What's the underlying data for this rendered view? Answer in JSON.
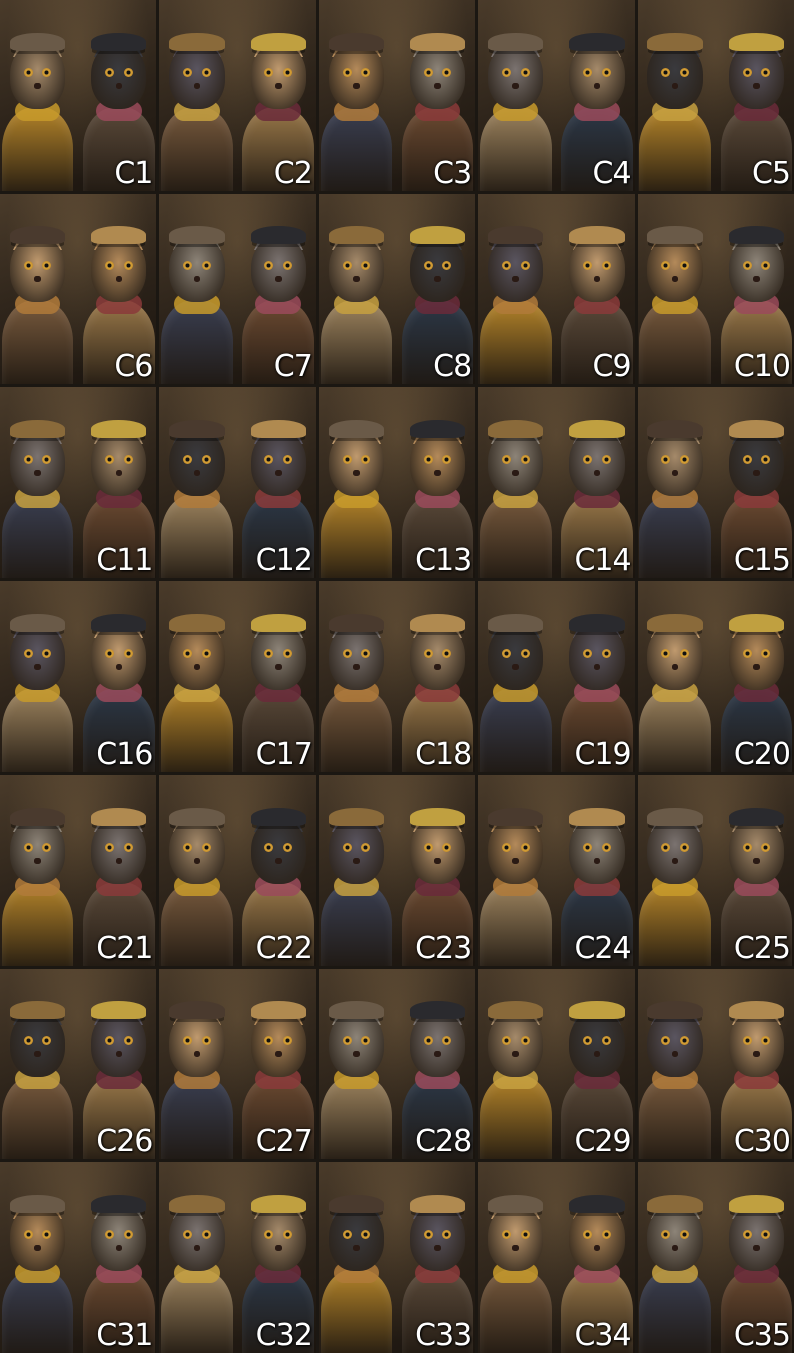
{
  "tiles": [
    {
      "label": "C1"
    },
    {
      "label": "C2"
    },
    {
      "label": "C3"
    },
    {
      "label": "C4"
    },
    {
      "label": "C5"
    },
    {
      "label": "C6"
    },
    {
      "label": "C7"
    },
    {
      "label": "C8"
    },
    {
      "label": "C9"
    },
    {
      "label": "C10"
    },
    {
      "label": "C11"
    },
    {
      "label": "C12"
    },
    {
      "label": "C13"
    },
    {
      "label": "C14"
    },
    {
      "label": "C15"
    },
    {
      "label": "C16"
    },
    {
      "label": "C17"
    },
    {
      "label": "C18"
    },
    {
      "label": "C19"
    },
    {
      "label": "C20"
    },
    {
      "label": "C21"
    },
    {
      "label": "C22"
    },
    {
      "label": "C23"
    },
    {
      "label": "C24"
    },
    {
      "label": "C25"
    },
    {
      "label": "C26"
    },
    {
      "label": "C27"
    },
    {
      "label": "C28"
    },
    {
      "label": "C29"
    },
    {
      "label": "C30"
    },
    {
      "label": "C31"
    },
    {
      "label": "C32"
    },
    {
      "label": "C33"
    },
    {
      "label": "C34"
    },
    {
      "label": "C35"
    }
  ],
  "palette": {
    "background": "#1b1712",
    "label_color": "#ffffff",
    "coats": [
      "#b7862a",
      "#5b4a3a",
      "#7a5b3e",
      "#9c7a4a",
      "#3a3f52",
      "#6d4b32",
      "#a08660",
      "#2c3848"
    ],
    "furs": [
      "#a58a6a",
      "#8d8478",
      "#c09a6e",
      "#3a3a3e",
      "#7b7370",
      "#b48a5a",
      "#5a5560"
    ],
    "scarves": [
      "#c79a2a",
      "#8a3a3a",
      "#b07a3a",
      "#6a2a3a",
      "#c6a040",
      "#9a4a5a"
    ],
    "hats": [
      "#6a5a48",
      "#2a2a2e",
      "#8a6a3a",
      "#c0a040",
      "#4a3a2e",
      "#b08a50"
    ]
  }
}
